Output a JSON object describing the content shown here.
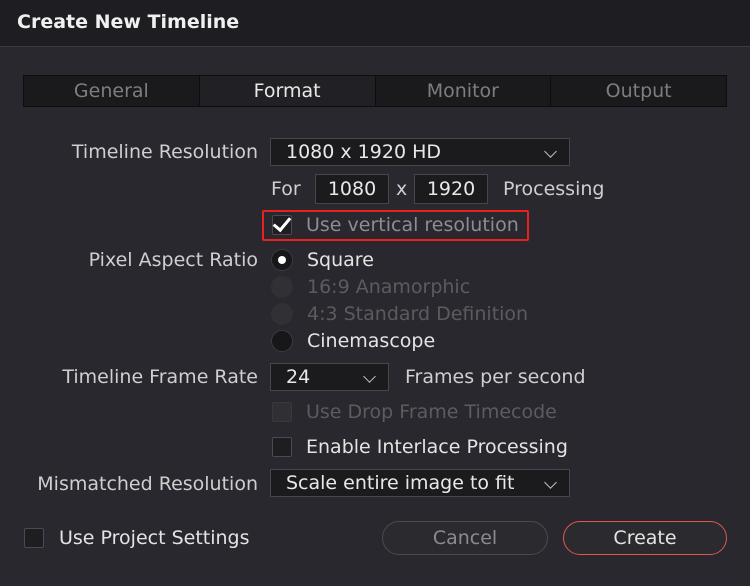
{
  "dialog": {
    "title": "Create New Timeline"
  },
  "tabs": [
    {
      "label": "General"
    },
    {
      "label": "Format",
      "active": true
    },
    {
      "label": "Monitor"
    },
    {
      "label": "Output"
    }
  ],
  "resolution": {
    "label": "Timeline Resolution",
    "selected": "1080 x 1920 HD",
    "for_label": "For",
    "width": "1080",
    "x_label": "x",
    "height": "1920",
    "processing_label": "Processing",
    "use_vertical_label": "Use vertical resolution",
    "use_vertical_checked": true
  },
  "pixel_aspect": {
    "label": "Pixel Aspect Ratio",
    "options": [
      {
        "label": "Square",
        "selected": true,
        "enabled": true
      },
      {
        "label": "16:9 Anamorphic",
        "selected": false,
        "enabled": false
      },
      {
        "label": "4:3 Standard Definition",
        "selected": false,
        "enabled": false
      },
      {
        "label": "Cinemascope",
        "selected": false,
        "enabled": true
      }
    ]
  },
  "frame_rate": {
    "label": "Timeline Frame Rate",
    "selected": "24",
    "unit": "Frames per second",
    "drop_frame_label": "Use Drop Frame Timecode",
    "drop_frame_enabled": false,
    "interlace_label": "Enable Interlace Processing",
    "interlace_checked": false
  },
  "mismatched": {
    "label": "Mismatched Resolution",
    "selected": "Scale entire image to fit"
  },
  "footer": {
    "use_project_settings_label": "Use Project Settings",
    "use_project_settings_checked": false,
    "cancel_label": "Cancel",
    "create_label": "Create"
  },
  "colors": {
    "highlight": "#e8201f",
    "create_border": "#e0574f",
    "background": "#28282e"
  }
}
